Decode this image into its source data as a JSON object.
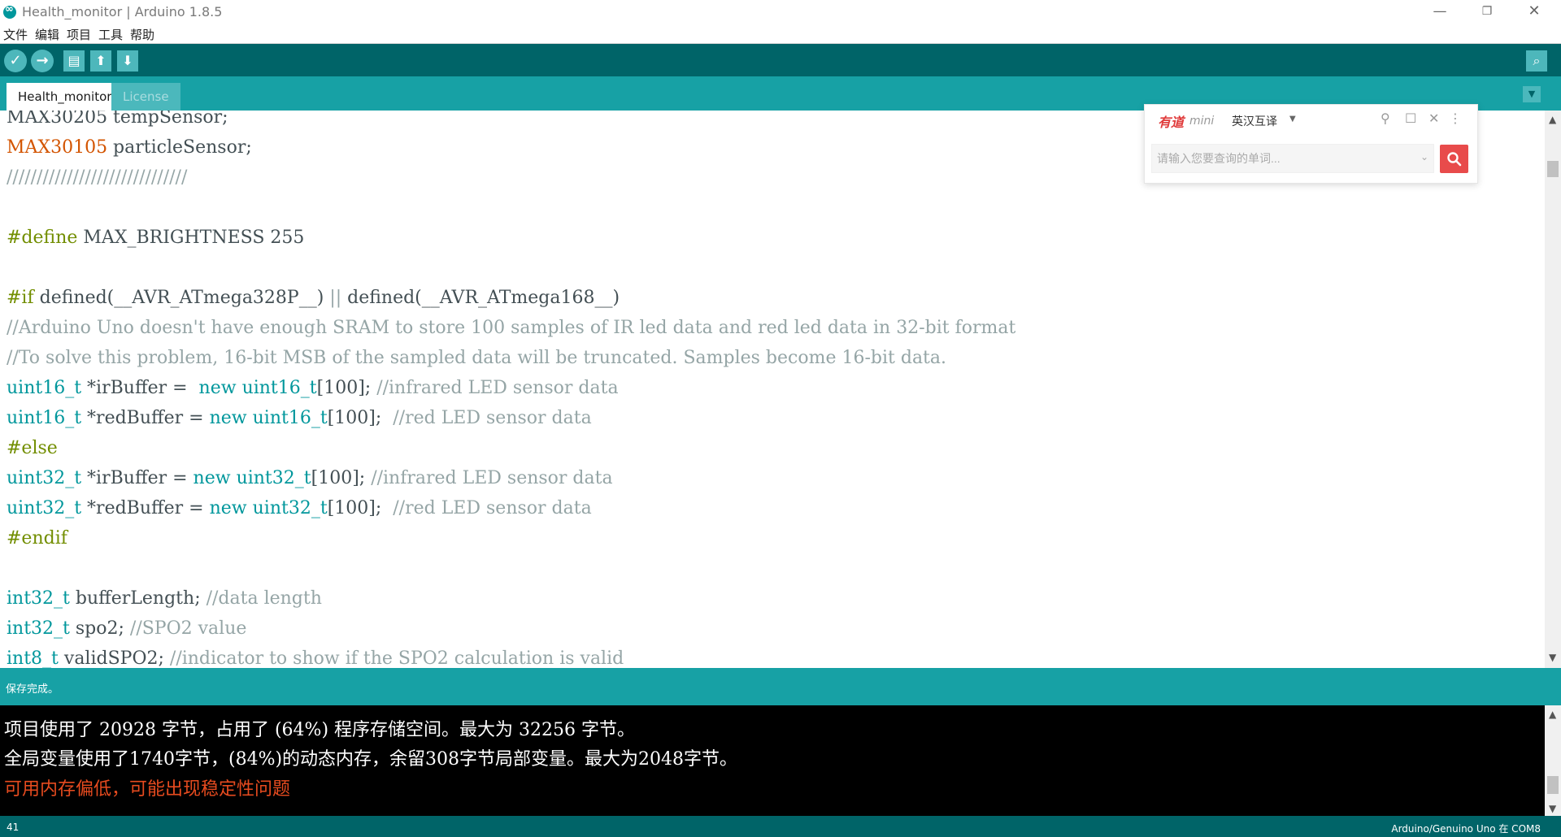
{
  "window": {
    "title": "Health_monitor | Arduino 1.8.5",
    "minimize_glyph": "—",
    "maximize_glyph": "❐",
    "close_glyph": "✕"
  },
  "menu": [
    "文件",
    "编辑",
    "项目",
    "工具",
    "帮助"
  ],
  "toolbar": {
    "verify_glyph": "✓",
    "upload_glyph": "→",
    "new_glyph": "▤",
    "open_glyph": "⬆",
    "save_glyph": "⬇",
    "serial_glyph": "⌕"
  },
  "tabs": [
    {
      "label": "Health_monitor",
      "active": true
    },
    {
      "label": "License",
      "active": false
    }
  ],
  "tab_menu_glyph": "▼",
  "editor": {
    "lines": [
      [
        {
          "t": "MAX30205 tempSensor;",
          "c": "plain"
        }
      ],
      [
        {
          "t": "MAX30105",
          "c": "kw-orange"
        },
        {
          "t": " particleSensor;",
          "c": "plain"
        }
      ],
      [
        {
          "t": "//////////////////////////////",
          "c": "cmt"
        }
      ],
      [],
      [
        {
          "t": "#define",
          "c": "pre"
        },
        {
          "t": " MAX_BRIGHTNESS 255",
          "c": "plain"
        }
      ],
      [],
      [
        {
          "t": "#if",
          "c": "pre"
        },
        {
          "t": " defined(__AVR_ATmega328P__) ",
          "c": "plain"
        },
        {
          "t": "||",
          "c": "cmt"
        },
        {
          "t": " defined(__AVR_ATmega168__)",
          "c": "plain"
        }
      ],
      [
        {
          "t": "//Arduino Uno doesn't have enough SRAM to store 100 samples of IR led data and red led data in 32-bit format",
          "c": "cmt"
        }
      ],
      [
        {
          "t": "//To solve this problem, 16-bit MSB of the sampled data will be truncated. Samples become 16-bit data.",
          "c": "cmt"
        }
      ],
      [
        {
          "t": "uint16_t",
          "c": "kw-teal"
        },
        {
          "t": " *irBuffer =  ",
          "c": "plain"
        },
        {
          "t": "new",
          "c": "kw-teal"
        },
        {
          "t": " ",
          "c": "plain"
        },
        {
          "t": "uint16_t",
          "c": "kw-teal"
        },
        {
          "t": "[100]; ",
          "c": "plain"
        },
        {
          "t": "//infrared LED sensor data",
          "c": "cmt"
        }
      ],
      [
        {
          "t": "uint16_t",
          "c": "kw-teal"
        },
        {
          "t": " *redBuffer = ",
          "c": "plain"
        },
        {
          "t": "new",
          "c": "kw-teal"
        },
        {
          "t": " ",
          "c": "plain"
        },
        {
          "t": "uint16_t",
          "c": "kw-teal"
        },
        {
          "t": "[100];  ",
          "c": "plain"
        },
        {
          "t": "//red LED sensor data",
          "c": "cmt"
        }
      ],
      [
        {
          "t": "#else",
          "c": "pre"
        }
      ],
      [
        {
          "t": "uint32_t",
          "c": "kw-teal"
        },
        {
          "t": " *irBuffer = ",
          "c": "plain"
        },
        {
          "t": "new",
          "c": "kw-teal"
        },
        {
          "t": " ",
          "c": "plain"
        },
        {
          "t": "uint32_t",
          "c": "kw-teal"
        },
        {
          "t": "[100]; ",
          "c": "plain"
        },
        {
          "t": "//infrared LED sensor data",
          "c": "cmt"
        }
      ],
      [
        {
          "t": "uint32_t",
          "c": "kw-teal"
        },
        {
          "t": " *redBuffer = ",
          "c": "plain"
        },
        {
          "t": "new",
          "c": "kw-teal"
        },
        {
          "t": " ",
          "c": "plain"
        },
        {
          "t": "uint32_t",
          "c": "kw-teal"
        },
        {
          "t": "[100];  ",
          "c": "plain"
        },
        {
          "t": "//red LED sensor data",
          "c": "cmt"
        }
      ],
      [
        {
          "t": "#endif",
          "c": "pre"
        }
      ],
      [],
      [
        {
          "t": "int32_t",
          "c": "kw-teal"
        },
        {
          "t": " bufferLength; ",
          "c": "plain"
        },
        {
          "t": "//data length",
          "c": "cmt"
        }
      ],
      [
        {
          "t": "int32_t",
          "c": "kw-teal"
        },
        {
          "t": " spo2; ",
          "c": "plain"
        },
        {
          "t": "//SPO2 value",
          "c": "cmt"
        }
      ],
      [
        {
          "t": "int8_t",
          "c": "kw-teal"
        },
        {
          "t": " validSPO2; ",
          "c": "plain"
        },
        {
          "t": "//indicator to show if the SPO2 calculation is valid",
          "c": "cmt"
        }
      ]
    ]
  },
  "translator": {
    "logo": "有道",
    "mini": "mini",
    "language": "英汉互译",
    "caret": "▼",
    "pin_glyph": "⚲",
    "maximize_glyph": "☐",
    "close_glyph": "✕",
    "more_glyph": "⋮",
    "placeholder": "请输入您要查询的单词...",
    "dropdown_glyph": "⌄"
  },
  "status": {
    "message": "保存完成。"
  },
  "console": {
    "lines": [
      {
        "t": "项目使用了 20928 字节，占用了 (64%) 程序存储空间。最大为 32256 字节。",
        "c": "c-white"
      },
      {
        "t": "全局变量使用了1740字节，(84%)的动态内存，余留308字节局部变量。最大为2048字节。",
        "c": "c-white"
      },
      {
        "t": "可用内存偏低，可能出现稳定性问题",
        "c": "c-red"
      }
    ]
  },
  "scroll": {
    "up_glyph": "▲",
    "down_glyph": "▼"
  },
  "bottom": {
    "line_number": "41",
    "board": "Arduino/Genuino Uno 在 COM8"
  }
}
